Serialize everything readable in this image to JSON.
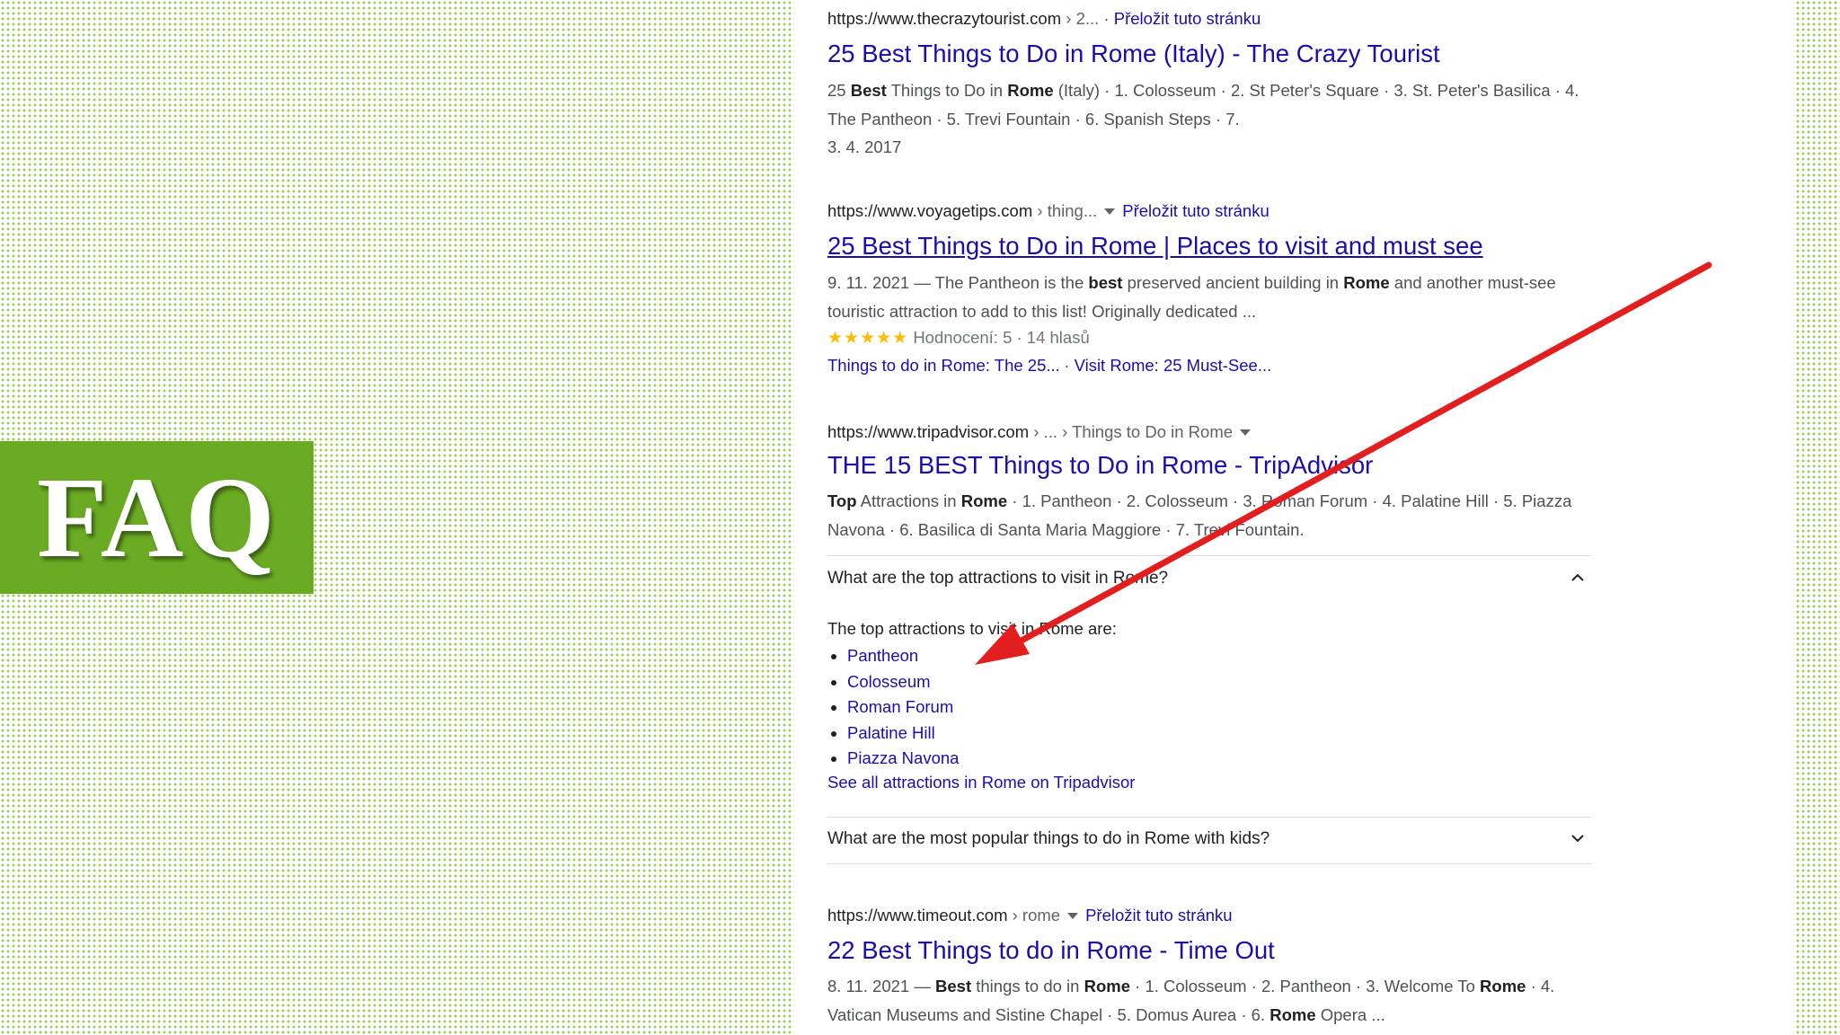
{
  "faq_label": "FAQ",
  "results": [
    {
      "site": "https://www.thecrazytourist.com",
      "path": " › 2...",
      "translate": "Přeložit tuto stránku",
      "title": "25 Best Things to Do in Rome (Italy) - The Crazy Tourist",
      "snippet_parts": [
        [
          "25 ",
          "n"
        ],
        [
          "Best",
          "b"
        ],
        [
          " Things to Do in ",
          "n"
        ],
        [
          "Rome",
          "b"
        ],
        [
          " (Italy) · 1. Colosseum · 2. St Peter's Square · 3. St. Peter's Basilica · 4. The Pantheon · 5. Trevi Fountain · 6. Spanish Steps · 7.",
          "n"
        ]
      ],
      "date": "3. 4. 2017"
    },
    {
      "site": "https://www.voyagetips.com",
      "path": " › thing...",
      "translate": "Přeložit tuto stránku",
      "title": "25 Best Things to Do in Rome | Places to visit and must see",
      "snippet_parts": [
        [
          "9. 11. 2021 — The Pantheon is the ",
          "n"
        ],
        [
          "best",
          "b"
        ],
        [
          " preserved ancient building in ",
          "n"
        ],
        [
          "Rome",
          "b"
        ],
        [
          " and another must-see touristic attraction to add to this list! Originally dedicated ...",
          "n"
        ]
      ],
      "stars": "★★★★★",
      "rating_text": "Hodnocení: 5 · 14 hlasů",
      "sitelinks": [
        "Things to do in Rome: The 25...",
        "Visit Rome: 25 Must-See..."
      ]
    },
    {
      "site": "https://www.tripadvisor.com",
      "path": " › ... › Things to Do in Rome",
      "title": "THE 15 BEST Things to Do in Rome - TripAdvisor",
      "snippet_parts": [
        [
          "Top",
          "b"
        ],
        [
          " Attractions in ",
          "n"
        ],
        [
          "Rome",
          "b"
        ],
        [
          " · 1. Pantheon · 2. Colosseum · 3. Roman Forum · 4. Palatine Hill · 5. Piazza Navona · 6. Basilica di Santa Maria Maggiore · 7. Trevi Fountain.",
          "n"
        ]
      ],
      "faq": [
        {
          "question": "What are the top attractions to visit in Rome?",
          "answer_intro": "The top attractions to visit in Rome are:",
          "answer_items": [
            "Pantheon",
            "Colosseum",
            "Roman Forum",
            "Palatine Hill",
            "Piazza Navona"
          ],
          "answer_link": "See all attractions in Rome on Tripadvisor"
        },
        {
          "question": "What are the most popular things to do in Rome with kids?"
        }
      ]
    },
    {
      "site": "https://www.timeout.com",
      "path": " › rome",
      "translate": "Přeložit tuto stránku",
      "title": "22 Best Things to do in Rome - Time Out",
      "snippet_parts": [
        [
          "8. 11. 2021 — ",
          "n"
        ],
        [
          "Best",
          "b"
        ],
        [
          " things to do in ",
          "n"
        ],
        [
          "Rome",
          "b"
        ],
        [
          " · 1. Colosseum · 2. Pantheon · 3. Welcome To ",
          "n"
        ],
        [
          "Rome",
          "b"
        ],
        [
          " · 4. Vatican Museums and Sistine Chapel · 5. Domus Aurea · 6. ",
          "n"
        ],
        [
          "Rome",
          "b"
        ],
        [
          " Opera ...",
          "n"
        ]
      ]
    }
  ],
  "colors": {
    "faq_bg": "#6aab23",
    "link": "#1a0dab",
    "arrow": "#e31e1e",
    "dots": "#9ccc5a"
  }
}
